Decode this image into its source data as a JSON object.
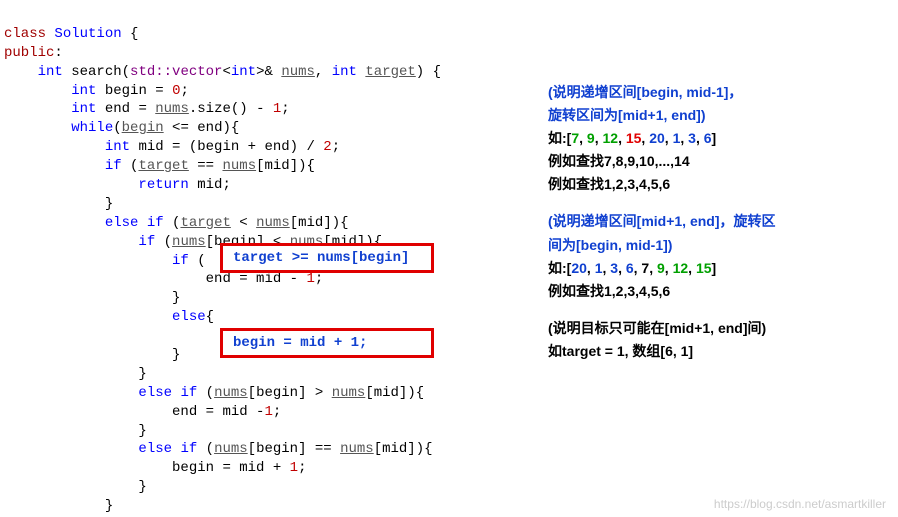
{
  "code": {
    "l01_class": "class",
    "l01_sol": "Solution",
    "l01_brace": " {",
    "l02_public": "public",
    "l02_colon": ":",
    "l03_int": "int",
    "l03_search": " search(",
    "l03_std": "std::vector",
    "l03_tint": "int",
    "l03_amp": ">& ",
    "l03_nums": "nums",
    "l03_comma": ", ",
    "l03_int2": "int",
    "l03_sp": " ",
    "l03_target": "target",
    "l03_close": ") {",
    "l04_int": "int",
    "l04_begin": " begin = ",
    "l04_zero": "0",
    "l04_semi": ";",
    "l05_int": "int",
    "l05_end": " end = ",
    "l05_nums": "nums",
    "l05_size": ".size() - ",
    "l05_one": "1",
    "l05_semi": ";",
    "l06_while": "while",
    "l06_cond": "(begin <= end){",
    "l06_begin": "begin",
    "l07_int": "int",
    "l07_mid1": " mid = (begin + end) / ",
    "l07_two": "2",
    "l07_semi": ";",
    "l08_if": "if",
    "l08_open": " (",
    "l08_target": "target",
    "l08_eq": " == ",
    "l08_nums": "nums",
    "l08_midref": "[mid]){",
    "l09_return": "return",
    "l09_mid": " mid;",
    "l10_brace": "}",
    "l11_else": "else",
    "l11_if": "if",
    "l11_open": " (",
    "l11_target": "target",
    "l11_lt": " < ",
    "l11_nums": "nums",
    "l11_close": "[mid]){",
    "l12_if": "if",
    "l12_open": " (",
    "l12_numsb": "nums",
    "l12_begin": "[begin]",
    "l12_lt": " < ",
    "l12_numsm": "nums",
    "l12_mid": "[mid]){",
    "l13_if": "if",
    "l13_open": " (",
    "l13_close": "){",
    "l14_stmt": "end = mid - ",
    "l14_one": "1",
    "l14_semi": ";",
    "l15_brace": "}",
    "l16_else": "else",
    "l16_brace": "{",
    "l17_brace": "}",
    "l18_brace": "}",
    "l19_else": "else",
    "l19_if": "if",
    "l19_open": " (",
    "l19_numsb": "nums",
    "l19_begin": "[begin]",
    "l19_gt": " > ",
    "l19_numsm": "nums",
    "l19_mid": "[mid]){",
    "l20_stmt": "end = mid -",
    "l20_one": "1",
    "l20_semi": ";",
    "l21_brace": "}",
    "l22_else": "else",
    "l22_if": "if",
    "l22_open": " (",
    "l22_numsb": "nums",
    "l22_begin": "[begin]",
    "l22_eq": " == ",
    "l22_numsm": "nums",
    "l22_mid": "[mid]){",
    "l23_stmt": "begin = mid + ",
    "l23_one": "1",
    "l23_semi": ";",
    "l24_brace": "}",
    "l25_brace": "}"
  },
  "redbox1": "target >= nums[begin]",
  "redbox2": "begin = mid + 1;",
  "anno": {
    "a1l1": "(说明递增区间[begin, mid-1]，",
    "a1l2": "旋转区间为[mid+1, end])",
    "a1pfx": "如:[",
    "a1_7": "7",
    "a1_9": "9",
    "a1_12": "12",
    "a1_15": "15",
    "a1_20": "20",
    "a1_1": "1",
    "a1_3": "3",
    "a1_6": "6",
    "a1_close": "]",
    "a1ex1": "例如查找7,8,9,10,...,14",
    "a1ex2": "例如查找1,2,3,4,5,6",
    "a2l1": "(说明递增区间[mid+1, end]，旋转区",
    "a2l2": "间为[begin, mid-1])",
    "a2pfx": "如:[",
    "a2_20": "20",
    "a2_1": "1",
    "a2_3": "3",
    "a2_6": "6",
    "a2_7": "7",
    "a2_9": "9",
    "a2_12": "12",
    "a2_15": "15",
    "a2_close": "]",
    "a2ex1": "例如查找1,2,3,4,5,6",
    "a3l1": "(说明目标只可能在[mid+1, end]间)",
    "a3l2": "如target = 1, 数组[6, 1]"
  },
  "watermark": "https://blog.csdn.net/asmartkiller",
  "sep": ", "
}
